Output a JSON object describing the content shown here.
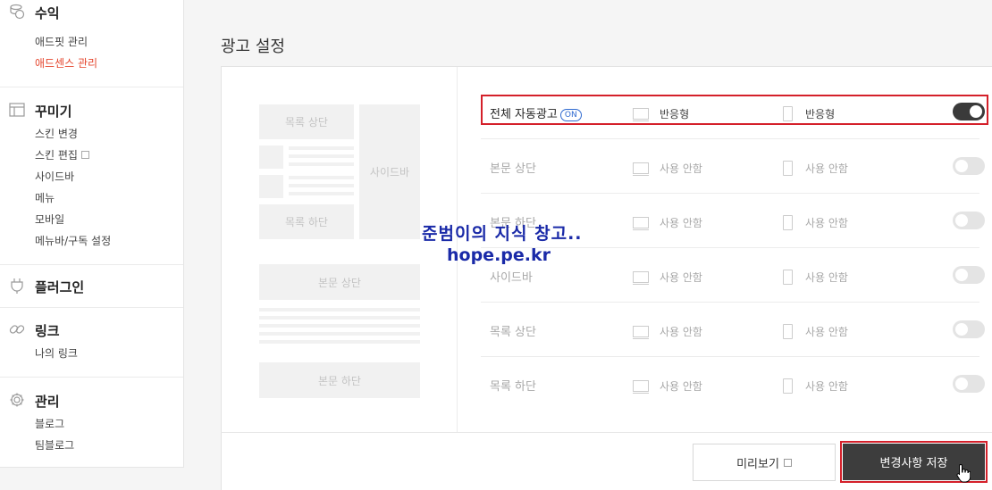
{
  "sidebar": {
    "revenue": {
      "title": "수익",
      "icon": "coins-icon",
      "items": [
        "애드핏 관리",
        "애드센스 관리"
      ]
    },
    "decorate": {
      "title": "꾸미기",
      "icon": "layout-icon",
      "items": [
        "스킨 변경",
        "스킨 편집",
        "사이드바",
        "메뉴",
        "모바일",
        "메뉴바/구독 설정"
      ]
    },
    "plugin": {
      "title": "플러그인",
      "icon": "plug-icon"
    },
    "link": {
      "title": "링크",
      "icon": "link-icon",
      "items": [
        "나의 링크"
      ]
    },
    "manage": {
      "title": "관리",
      "icon": "gear-icon",
      "items": [
        "블로그",
        "팀블로그"
      ]
    },
    "accent_color": "#e5472f"
  },
  "main": {
    "title": "광고 설정",
    "preview": {
      "list_top": "목록 상단",
      "list_bottom": "목록 하단",
      "sidebar": "사이드바",
      "body_top": "본문 상단",
      "body_bottom": "본문 하단"
    },
    "rows": [
      {
        "label": "전체 자동광고",
        "badge": "ON",
        "pc": "반응형",
        "mobile": "반응형",
        "enabled": true
      },
      {
        "label": "본문 상단",
        "pc": "사용 안함",
        "mobile": "사용 안함",
        "enabled": false
      },
      {
        "label": "본문 하단",
        "pc": "사용 안함",
        "mobile": "사용 안함",
        "enabled": false
      },
      {
        "label": "사이드바",
        "pc": "사용 안함",
        "mobile": "사용 안함",
        "enabled": false
      },
      {
        "label": "목록 상단",
        "pc": "사용 안함",
        "mobile": "사용 안함",
        "enabled": false
      },
      {
        "label": "목록 하단",
        "pc": "사용 안함",
        "mobile": "사용 안함",
        "enabled": false
      }
    ],
    "preview_button": "미리보기",
    "save_button": "변경사항 저장"
  },
  "watermark": {
    "line1": "준범이의 지식 창고..",
    "line2": "hope.pe.kr"
  },
  "colors": {
    "highlight": "#d4202a",
    "on_badge": "#2f6ad0",
    "save_bg": "#3d3d3d"
  }
}
